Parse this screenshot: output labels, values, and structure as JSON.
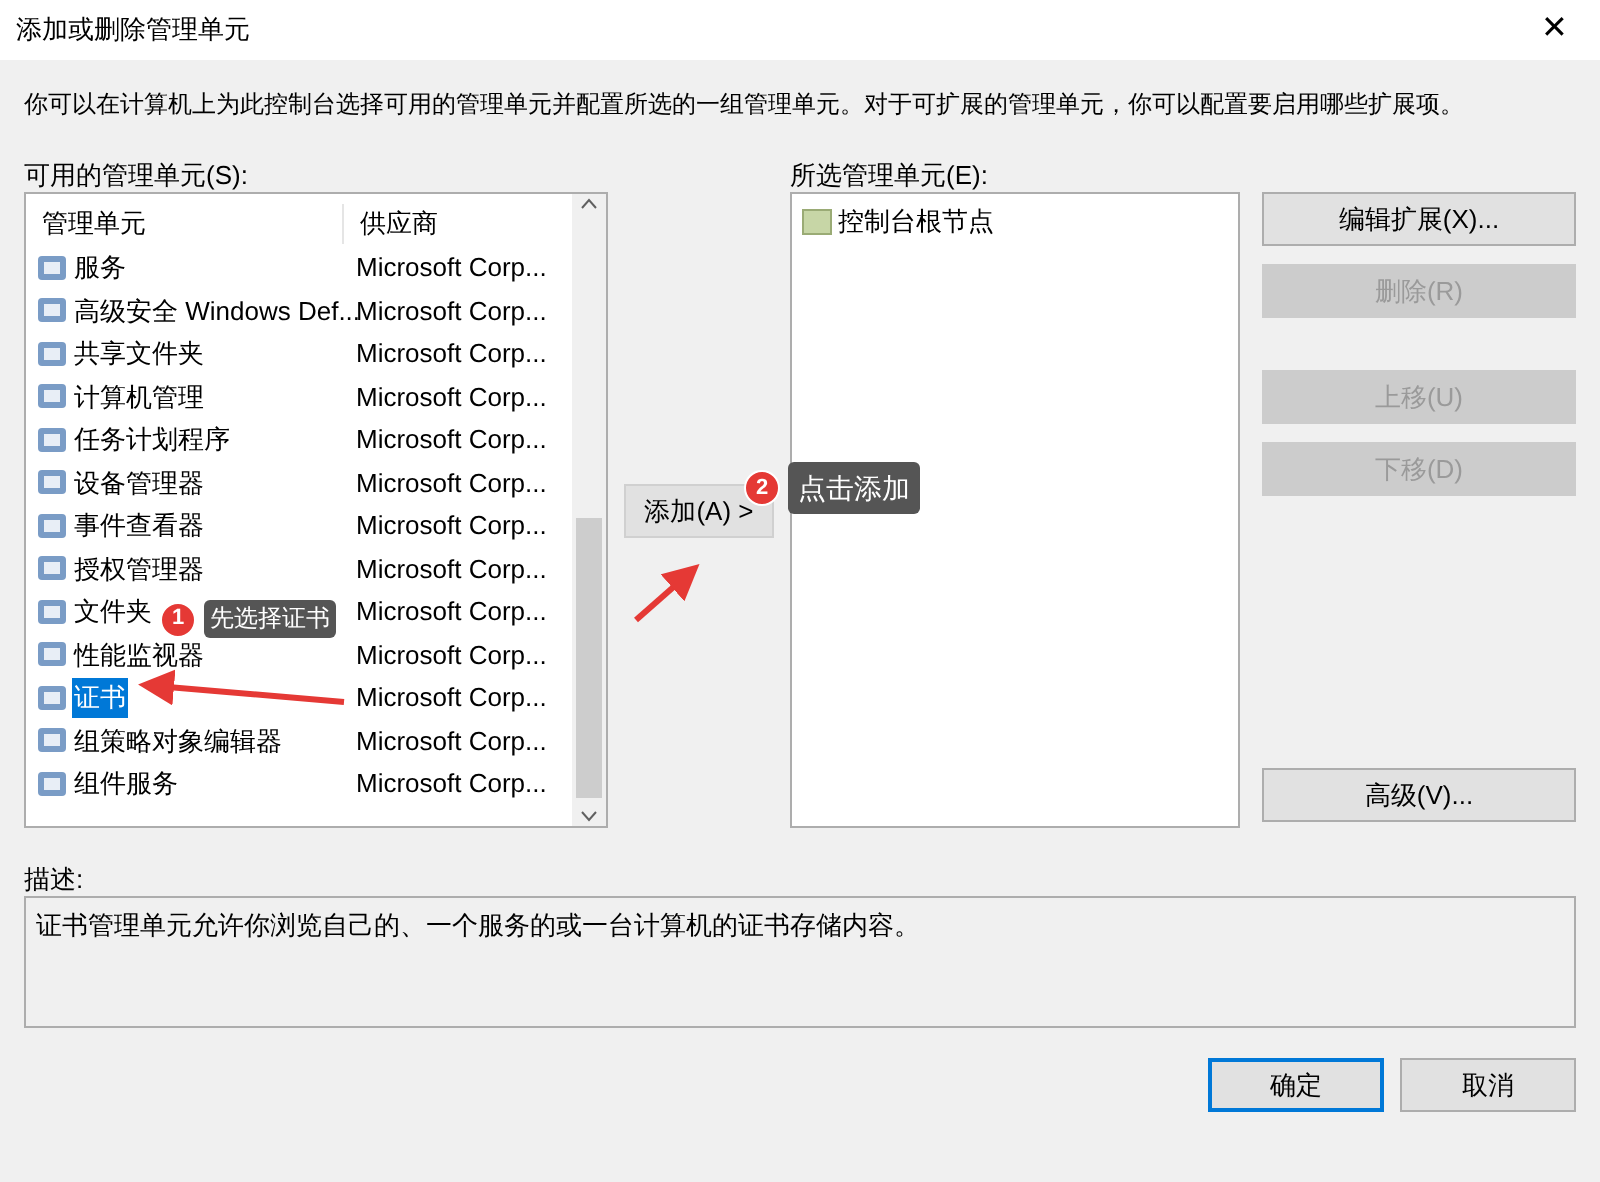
{
  "window": {
    "title": "添加或删除管理单元",
    "close": "✕"
  },
  "intro": "你可以在计算机上为此控制台选择可用的管理单元并配置所选的一组管理单元。对于可扩展的管理单元，你可以配置要启用哪些扩展项。",
  "available": {
    "label": "可用的管理单元(S):",
    "columns": [
      "管理单元",
      "供应商"
    ],
    "rows": [
      {
        "name": "服务",
        "vendor": "Microsoft Corp...",
        "selected": false
      },
      {
        "name": "高级安全 Windows Def...",
        "vendor": "Microsoft Corp...",
        "selected": false
      },
      {
        "name": "共享文件夹",
        "vendor": "Microsoft Corp...",
        "selected": false
      },
      {
        "name": "计算机管理",
        "vendor": "Microsoft Corp...",
        "selected": false
      },
      {
        "name": "任务计划程序",
        "vendor": "Microsoft Corp...",
        "selected": false
      },
      {
        "name": "设备管理器",
        "vendor": "Microsoft Corp...",
        "selected": false
      },
      {
        "name": "事件查看器",
        "vendor": "Microsoft Corp...",
        "selected": false
      },
      {
        "name": "授权管理器",
        "vendor": "Microsoft Corp...",
        "selected": false
      },
      {
        "name": "文件夹",
        "vendor": "Microsoft Corp...",
        "selected": false
      },
      {
        "name": "性能监视器",
        "vendor": "Microsoft Corp...",
        "selected": false
      },
      {
        "name": "证书",
        "vendor": "Microsoft Corp...",
        "selected": true
      },
      {
        "name": "组策略对象编辑器",
        "vendor": "Microsoft Corp...",
        "selected": false
      },
      {
        "name": "组件服务",
        "vendor": "Microsoft Corp...",
        "selected": false
      }
    ]
  },
  "add_button": "添加(A) >",
  "selected_list": {
    "label": "所选管理单元(E):",
    "items": [
      "控制台根节点"
    ]
  },
  "side_buttons": [
    {
      "label": "编辑扩展(X)...",
      "disabled": false
    },
    {
      "label": "删除(R)",
      "disabled": true
    },
    {
      "label": "上移(U)",
      "disabled": true
    },
    {
      "label": "下移(D)",
      "disabled": true
    },
    {
      "label": "高级(V)...",
      "disabled": false
    }
  ],
  "description": {
    "label": "描述:",
    "text": "证书管理单元允许你浏览自己的、一个服务的或一台计算机的证书存储内容。"
  },
  "footer_buttons": [
    {
      "label": "确定",
      "default": true
    },
    {
      "label": "取消",
      "default": false
    }
  ],
  "callouts": [
    {
      "number": "1",
      "text": "先选择证书"
    },
    {
      "number": "2",
      "text": "点击添加"
    }
  ]
}
